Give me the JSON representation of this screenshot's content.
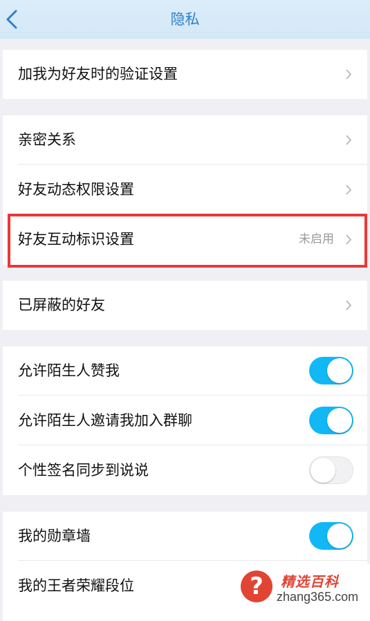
{
  "header": {
    "title": "隐私",
    "back_icon": "chevron-left-icon"
  },
  "groups": [
    {
      "rows": [
        {
          "label": "加我为好友时的验证设置",
          "type": "link"
        }
      ]
    },
    {
      "rows": [
        {
          "label": "亲密关系",
          "type": "link"
        },
        {
          "label": "好友动态权限设置",
          "type": "link"
        },
        {
          "label": "好友互动标识设置",
          "type": "link",
          "value": "未启用"
        }
      ]
    },
    {
      "rows": [
        {
          "label": "已屏蔽的好友",
          "type": "link"
        }
      ]
    },
    {
      "rows": [
        {
          "label": "允许陌生人赞我",
          "type": "toggle",
          "on": true
        },
        {
          "label": "允许陌生人邀请我加入群聊",
          "type": "toggle",
          "on": true
        },
        {
          "label": "个性签名同步到说说",
          "type": "toggle",
          "on": false
        }
      ]
    },
    {
      "rows": [
        {
          "label": "我的勋章墙",
          "type": "toggle",
          "on": true
        },
        {
          "label": "我的王者荣耀段位",
          "type": "toggle",
          "on": false
        }
      ]
    }
  ],
  "watermark": {
    "title": "精选百科",
    "url": "zhang365.com",
    "icon": "question-mark-icon"
  },
  "colors": {
    "accent": "#12b7f5",
    "title": "#2c7fc8",
    "highlight_border": "#e93838",
    "header_bg": "#d8eaf8",
    "watermark": "#e24434"
  }
}
